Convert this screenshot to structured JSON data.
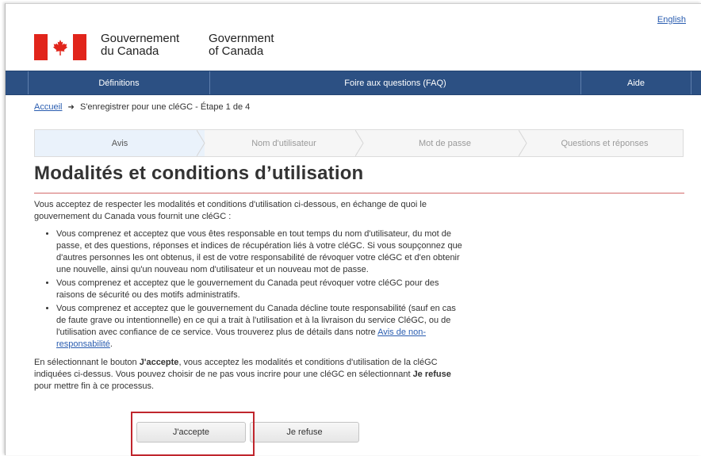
{
  "header": {
    "lang_link": "English",
    "wordmark_fr": [
      "Gouvernement",
      "du Canada"
    ],
    "wordmark_en": [
      "Government",
      "of Canada"
    ],
    "flag_colors": {
      "red": "#e1251b",
      "white": "#ffffff"
    }
  },
  "nav": {
    "items": [
      "Définitions",
      "Foire aux questions (FAQ)",
      "Aide"
    ],
    "color": "#2c5083"
  },
  "breadcrumb": {
    "home": "Accueil",
    "current": "S'enregistrer pour une cléGC - Étape 1 de 4"
  },
  "steps": [
    "Avis",
    "Nom d'utilisateur",
    "Mot de passe",
    "Questions et réponses"
  ],
  "page": {
    "title": "Modalités et conditions d’utilisation",
    "intro": "Vous acceptez de respecter les modalités et conditions d'utilisation ci-dessous, en échange de quoi le gouvernement du Canada vous fournit une cléGC :",
    "bullets": [
      "Vous comprenez et acceptez que vous êtes responsable en tout temps du nom d'utilisateur, du mot de passe, et des questions, réponses et indices de récupération liés à votre cléGC. Si vous soupçonnez que d'autres personnes les ont obtenus, il est de votre responsabilité de révoquer votre cléGC et d'en obtenir une nouvelle, ainsi qu'un nouveau nom d'utilisateur et un nouveau mot de passe.",
      "Vous comprenez et acceptez que le gouvernement du Canada peut révoquer votre cléGC pour des raisons de sécurité ou des motifs administratifs."
    ],
    "bullet3_text": "Vous comprenez et acceptez que le gouvernement du Canada décline toute responsabilité (sauf en cas de faute grave ou intentionnelle) en ce qui a trait à l'utilisation et à la livraison du service CléGC, ou de l'utilisation avec confiance de ce service. Vous trouverez plus de détails dans notre ",
    "bullet3_link": "Avis de non-responsabilité",
    "bullet3_end": ".",
    "outro_1": "En sélectionnant le bouton ",
    "outro_accept": "J'accepte",
    "outro_2": ", vous acceptez les modalités et conditions d'utilisation de la cléGC indiquées ci-dessus. Vous pouvez choisir de ne pas vous incrire pour une cléGC en sélectionnant ",
    "outro_refuse": "Je refuse",
    "outro_3": " pour mettre fin à ce processus."
  },
  "buttons": {
    "accept": "J'accepte",
    "refuse": "Je refuse"
  },
  "highlight_color": "#c0262d"
}
